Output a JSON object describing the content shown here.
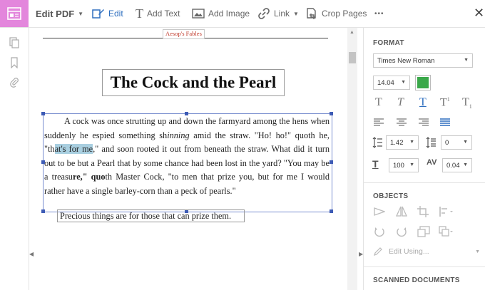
{
  "toolbar": {
    "mode_label": "Edit PDF",
    "items": [
      {
        "label": "Edit",
        "icon": "edit-icon",
        "active": true
      },
      {
        "label": "Add Text",
        "icon": "text-icon"
      },
      {
        "label": "Add Image",
        "icon": "image-icon"
      },
      {
        "label": "Link",
        "icon": "link-icon"
      },
      {
        "label": "Crop Pages",
        "icon": "crop-icon"
      }
    ],
    "more": "•••",
    "close": "✕"
  },
  "document": {
    "header": "Aesop's Fables",
    "title": "The Cock and the Pearl",
    "paragraph": {
      "part1": "A cock was once strutting up and down the farmyard among the hens when suddenly he espied something sh",
      "italic": "inning",
      "part2": " amid the straw. \"Ho! ho!\" quoth he, \"th",
      "highlight": "at's for me",
      "part3": ",\" and soon rooted it out from beneath the straw. What did it turn out to be but a Pearl that by some chance had been lost in the yard?  \"You may be a treasu",
      "bold1": "re,\" quo",
      "part4": "th Master Cock, \"to men that prize you, but for me I would rather have a single barley-corn than a peck of pearls.\""
    },
    "moral": "Precious things are for those that can prize them."
  },
  "panel": {
    "format_title": "FORMAT",
    "font_family": "Times New Roman",
    "font_size": "14.04",
    "text_color": "#3aa84a",
    "line_spacing": "1.42",
    "para_spacing": "0",
    "scale": "100",
    "char_spacing": "0.04",
    "objects_title": "OBJECTS",
    "edit_using": "Edit Using...",
    "scanned_title": "SCANNED DOCUMENTS"
  },
  "colors": {
    "mode_tile": "#e386dc",
    "active": "#2e6fbf",
    "header_red": "#c0392b",
    "selection": "#a9cfe0"
  }
}
